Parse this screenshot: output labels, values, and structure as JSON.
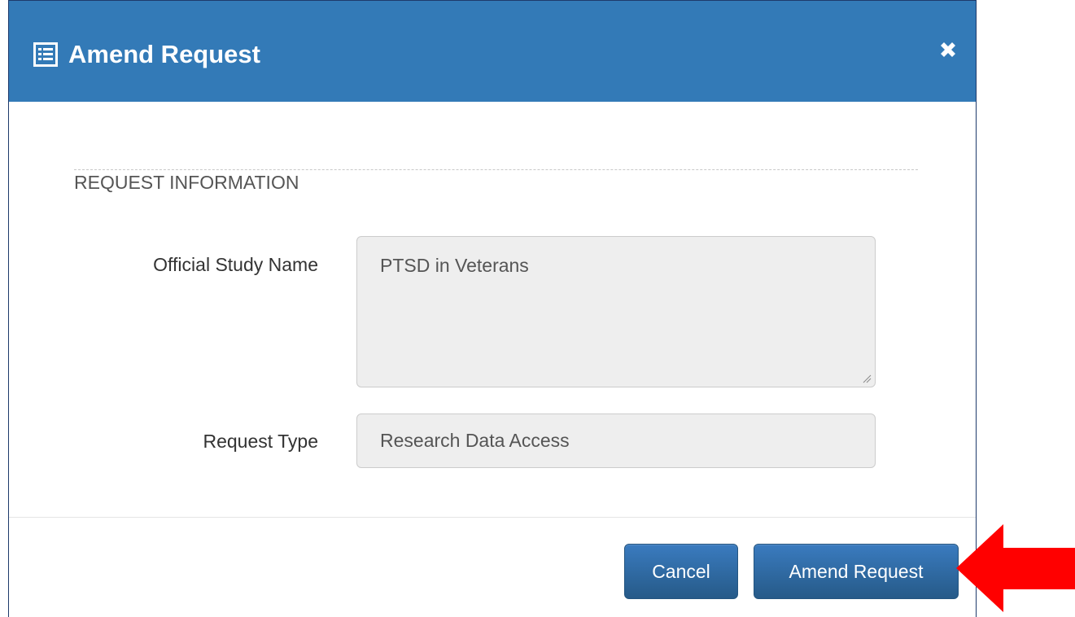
{
  "dialog": {
    "title": "Amend Request",
    "header_color": "#337ab7",
    "title_icon": "list-alt-icon",
    "close_icon": "close-icon"
  },
  "section": {
    "title": "REQUEST INFORMATION"
  },
  "fields": {
    "study_name": {
      "label": "Official Study Name",
      "value": "PTSD in Veterans"
    },
    "request_type": {
      "label": "Request Type",
      "value": "Research Data Access"
    }
  },
  "footer": {
    "cancel_label": "Cancel",
    "amend_label": "Amend Request",
    "button_color": "#337ab7"
  },
  "annotation": {
    "arrow_icon": "red-arrow-icon",
    "arrow_color": "#ff0000"
  }
}
